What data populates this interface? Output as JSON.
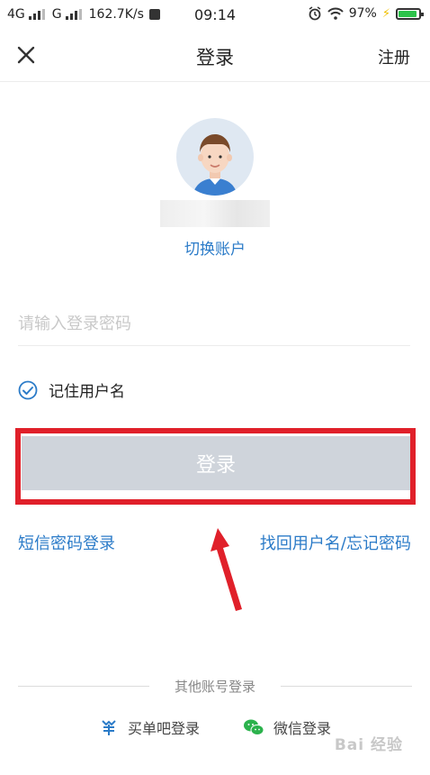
{
  "status_bar": {
    "network1": "4G",
    "network2": "G",
    "speed": "162.7K/s",
    "time": "09:14",
    "battery": "97%"
  },
  "nav": {
    "title": "登录",
    "register": "注册"
  },
  "account": {
    "username": "",
    "switch_label": "切换账户"
  },
  "password": {
    "placeholder": "请输入登录密码",
    "value": ""
  },
  "remember": {
    "label": "记住用户名",
    "checked": true
  },
  "login_button": "登录",
  "links": {
    "sms_login": "短信密码登录",
    "forgot": "找回用户名/忘记密码"
  },
  "other": {
    "label": "其他账号登录",
    "options": [
      "买单吧登录",
      "微信登录"
    ]
  },
  "icons": [
    "close-icon",
    "avatar",
    "check-circle-icon",
    "maidanba-icon",
    "wechat-icon",
    "arrow"
  ],
  "colors": {
    "link": "#2b7bc8",
    "button": "#cfd4db",
    "highlight": "#e0202a",
    "arrow": "#e0202a"
  },
  "watermark": "Bai 经验"
}
